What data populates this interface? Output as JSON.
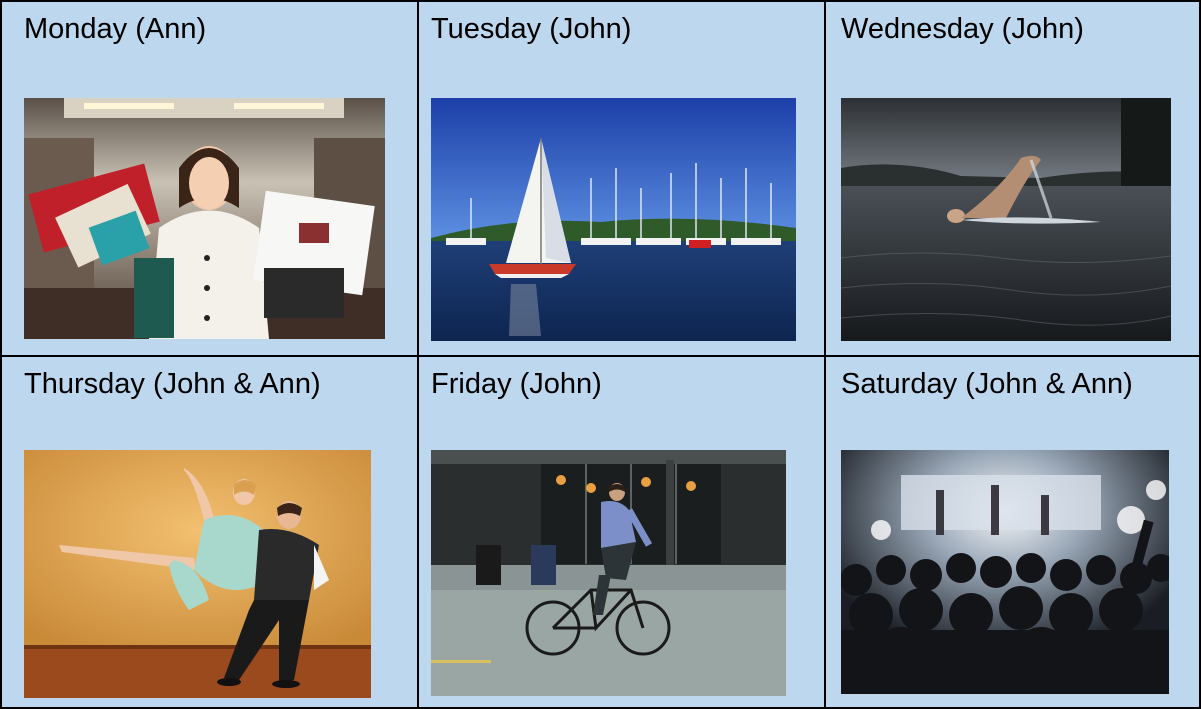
{
  "schedule": [
    {
      "day_label": "Monday (Ann)",
      "photo": "woman-shopping-bags-photo"
    },
    {
      "day_label": "Tuesday (John)",
      "photo": "sailboat-harbor-photo"
    },
    {
      "day_label": "Wednesday (John)",
      "photo": "swimmer-lake-photo"
    },
    {
      "day_label": "Thursday (John & Ann)",
      "photo": "ballroom-dancers-photo"
    },
    {
      "day_label": "Friday (John)",
      "photo": "cyclist-street-photo"
    },
    {
      "day_label": "Saturday (John & Ann)",
      "photo": "concert-crowd-photo"
    }
  ],
  "colors": {
    "cell_background": "#bdd7ee",
    "border": "#000000"
  }
}
